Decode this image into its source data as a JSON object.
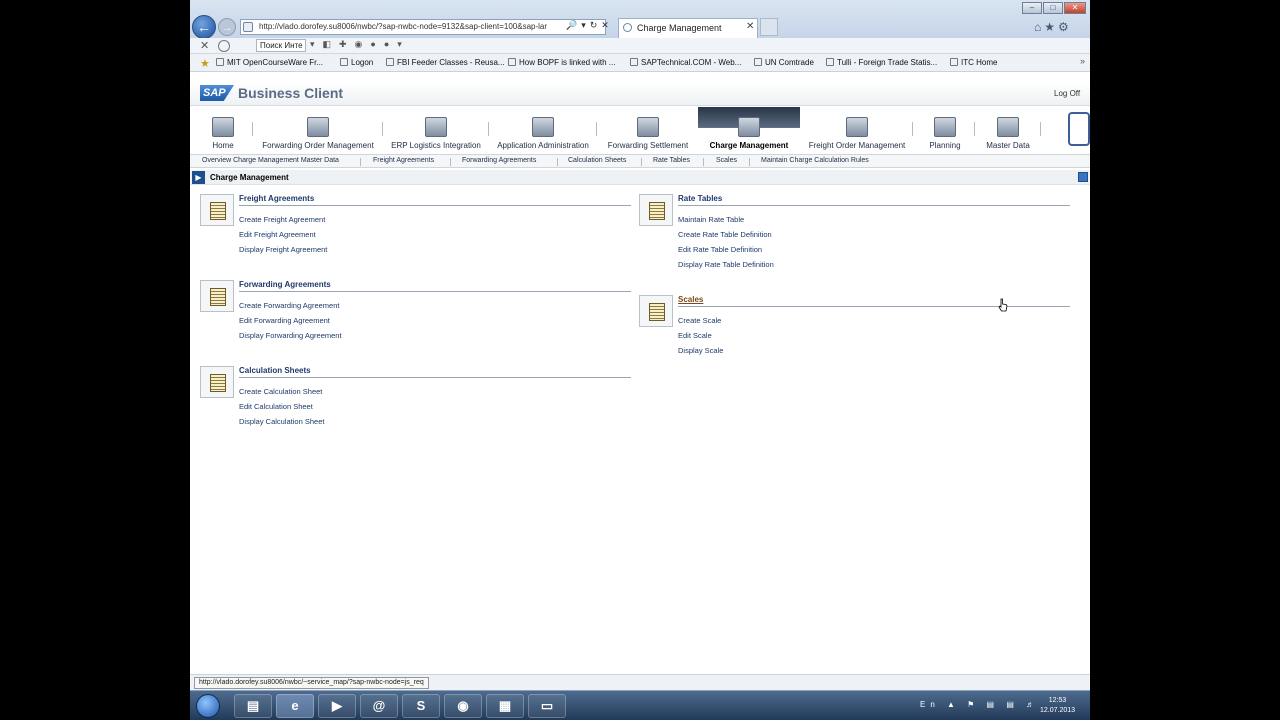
{
  "browser": {
    "address": "http://vlado.dorofey.su8006/nwbc/?sap-nwbc-node=9132&sap-client=100&sap-lar",
    "tab_title": "Charge Management",
    "search_placeholder": "Поиск Инте",
    "favorites": [
      "MIT OpenCourseWare  Fr...",
      "Logon",
      "FBI Feeder Classes - Reusa...",
      "How BOPF is linked with ...",
      "SAPTechnical.COM - Web...",
      "UN Comtrade",
      "Tulli - Foreign Trade Statis...",
      "ITC Home"
    ],
    "status_url": "http://vlado.dorofey.su8006/nwbc/~service_map/?sap-nwbc-node=js_req"
  },
  "sap": {
    "logo": "SAP",
    "title": "Business Client",
    "logoff": "Log Off"
  },
  "topnav": [
    {
      "label": "Home"
    },
    {
      "label": "Forwarding Order Management"
    },
    {
      "label": "ERP Logistics Integration"
    },
    {
      "label": "Application Administration"
    },
    {
      "label": "Forwarding Settlement"
    },
    {
      "label": "Charge Management",
      "active": true
    },
    {
      "label": "Freight Order Management"
    },
    {
      "label": "Planning"
    },
    {
      "label": "Master Data"
    }
  ],
  "subnav": [
    "Overview Charge Management Master Data",
    "Freight Agreements",
    "Forwarding Agreements",
    "Calculation Sheets",
    "Rate Tables",
    "Scales",
    "Maintain Charge Calculation Rules"
  ],
  "page": {
    "title": "Charge Management"
  },
  "groups": [
    {
      "title": "Freight Agreements",
      "links": [
        "Create Freight Agreement",
        "Edit Freight Agreement",
        "Display Freight Agreement"
      ]
    },
    {
      "title": "Forwarding Agreements",
      "links": [
        "Create Forwarding Agreement",
        "Edit Forwarding Agreement",
        "Display Forwarding Agreement"
      ]
    },
    {
      "title": "Calculation Sheets",
      "links": [
        "Create Calculation Sheet",
        "Edit Calculation Sheet",
        "Display Calculation Sheet"
      ]
    },
    {
      "title": "Rate Tables",
      "links": [
        "Maintain Rate Table",
        "Create Rate Table Definition",
        "Edit Rate Table Definition",
        "Display Rate Table Definition"
      ]
    },
    {
      "title": "Scales",
      "links": [
        "Create Scale",
        "Edit Scale",
        "Display Scale"
      ]
    }
  ],
  "taskbar": {
    "clock_time": "12:53",
    "clock_date": "12.07.2013",
    "lang": "En"
  }
}
